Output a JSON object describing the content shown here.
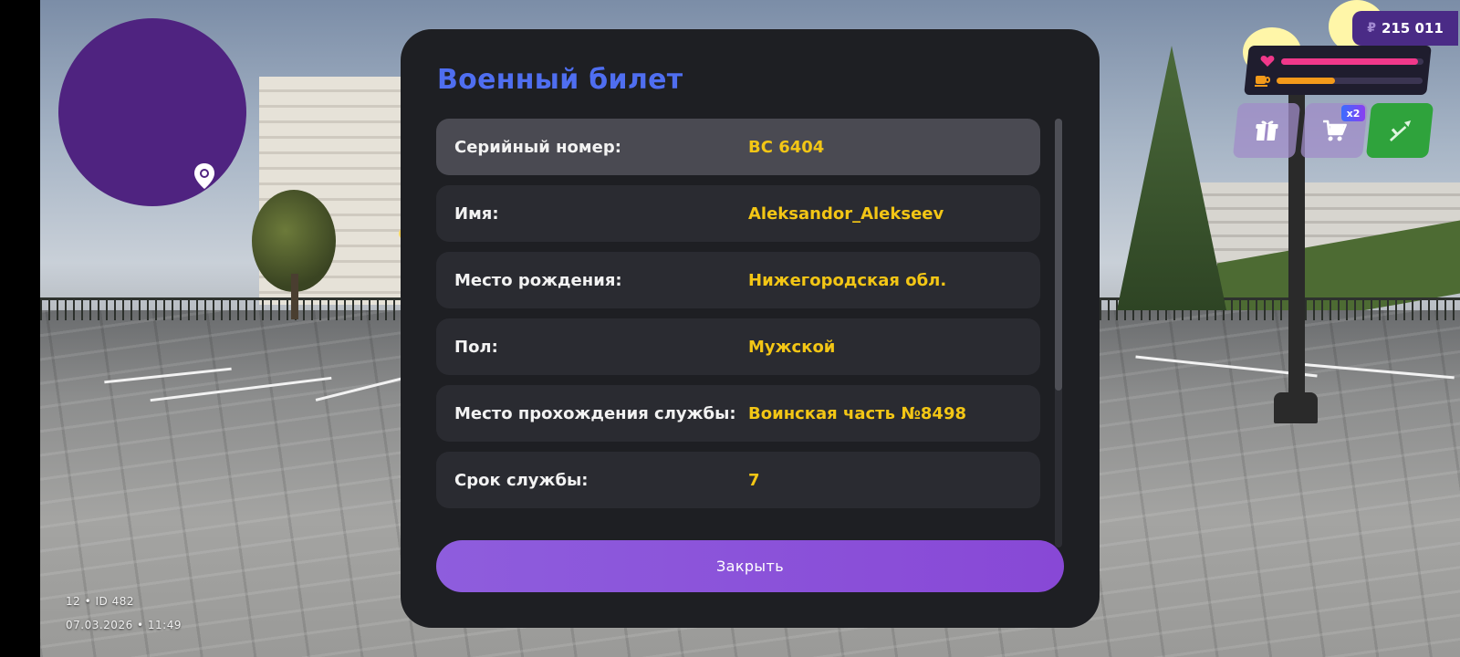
{
  "hud": {
    "currency_symbol": "₽",
    "money": "215 011",
    "health_fraction": 0.96,
    "hunger_fraction": 0.4,
    "multiplier_badge": "x2",
    "icons": [
      "gift-icon",
      "cart-icon",
      "weapon-icon",
      "heart-icon",
      "cup-icon",
      "location-pin-icon"
    ]
  },
  "info": {
    "server_line": "12 • ID 482",
    "datetime_line": "07.03.2026 • 11:49"
  },
  "dialog": {
    "title": "Военный билет",
    "rows": [
      {
        "label": "Серийный номер:",
        "value": "BC 6404"
      },
      {
        "label": "Имя:",
        "value": "Aleksandor_Alekseev"
      },
      {
        "label": "Место рождения:",
        "value": "Нижегородская обл."
      },
      {
        "label": "Пол:",
        "value": "Мужской"
      },
      {
        "label": "Место прохождения службы:",
        "value": "Воинская часть №8498"
      },
      {
        "label": "Срок службы:",
        "value": "7"
      }
    ],
    "close_label": "Закрыть"
  },
  "colors": {
    "title": "#4f6ef0",
    "value": "#f3c615",
    "button": "#8a52da",
    "minimap": "#4f2380",
    "health": "#f0388a",
    "hunger": "#f39a1a",
    "weapon_button": "#2fa33c"
  }
}
